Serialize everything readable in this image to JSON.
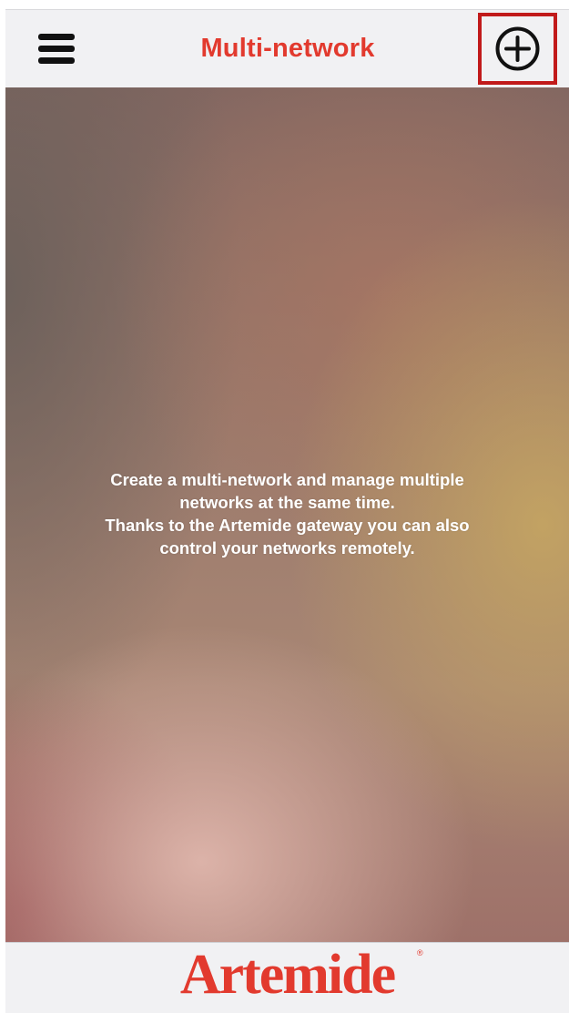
{
  "header": {
    "title": "Multi-network",
    "menu_icon": "hamburger-menu-icon",
    "add_icon": "plus-circle-icon",
    "highlight_color": "#c11a1a"
  },
  "main": {
    "message_lines": [
      "Create a multi-network and manage multiple",
      "networks at the same time.",
      "Thanks to the Artemide gateway you can also",
      "control your networks remotely."
    ]
  },
  "footer": {
    "brand": "Artemide",
    "brand_mark": "®"
  },
  "colors": {
    "accent": "#e23a2e",
    "bar_background": "#f1f1f3",
    "message_text": "#ffffff"
  }
}
